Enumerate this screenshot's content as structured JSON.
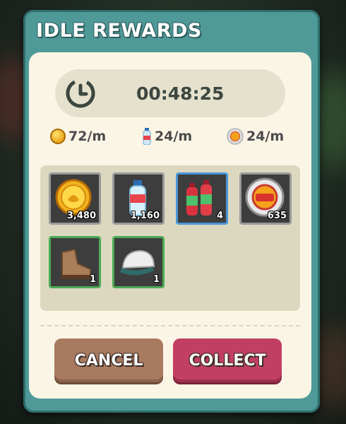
{
  "dialog": {
    "title": "IDLE REWARDS",
    "timer": "00:48:25"
  },
  "rates": [
    {
      "icon": "gold-coin-icon",
      "value": "72/m"
    },
    {
      "icon": "exp-bottle-icon",
      "value": "24/m"
    },
    {
      "icon": "exp-medal-icon",
      "value": "24/m"
    }
  ],
  "rewards": [
    {
      "name": "gold-coin",
      "qty": "3,480",
      "border": "gray"
    },
    {
      "name": "exp-bottle",
      "qty": "1,160",
      "border": "gray"
    },
    {
      "name": "energy-drinks",
      "qty": "4",
      "border": "blue"
    },
    {
      "name": "exp-medal",
      "qty": "635",
      "border": "gray"
    },
    {
      "name": "hiking-boots",
      "qty": "1",
      "border": "green"
    },
    {
      "name": "baseball-cap",
      "qty": "1",
      "border": "green"
    }
  ],
  "buttons": {
    "cancel": "CANCEL",
    "collect": "COLLECT"
  },
  "colors": {
    "frame": "#4f9a99",
    "panel": "#fbf5e6",
    "cancel": "#a87a60",
    "collect": "#c23f64",
    "rare_border": "#4a96d6",
    "uncommon_border": "#4daa55"
  }
}
